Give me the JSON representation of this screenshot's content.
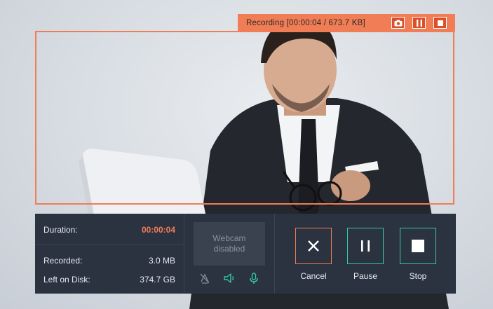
{
  "recording_toolbar": {
    "status_text": "Recording [00:00:04 / 673.7 KB]",
    "buttons": [
      {
        "icon": "camera-icon",
        "name": "screenshot"
      },
      {
        "icon": "pause-icon",
        "name": "pause"
      },
      {
        "icon": "stop-icon",
        "name": "stop"
      }
    ],
    "accent_color": "#f07d55"
  },
  "stats": {
    "duration_label": "Duration:",
    "duration_value": "00:00:04",
    "recorded_label": "Recorded:",
    "recorded_value": "3.0 MB",
    "disk_label": "Left on Disk:",
    "disk_value": "374.7 GB"
  },
  "webcam": {
    "line1": "Webcam",
    "line2": "disabled",
    "icons": [
      "webcam-off-icon",
      "speaker-icon",
      "microphone-icon"
    ]
  },
  "controls": {
    "cancel_label": "Cancel",
    "pause_label": "Pause",
    "stop_label": "Stop"
  },
  "colors": {
    "panel_bg": "#2b3341",
    "orange": "#f07d55",
    "teal": "#34c9a4"
  }
}
